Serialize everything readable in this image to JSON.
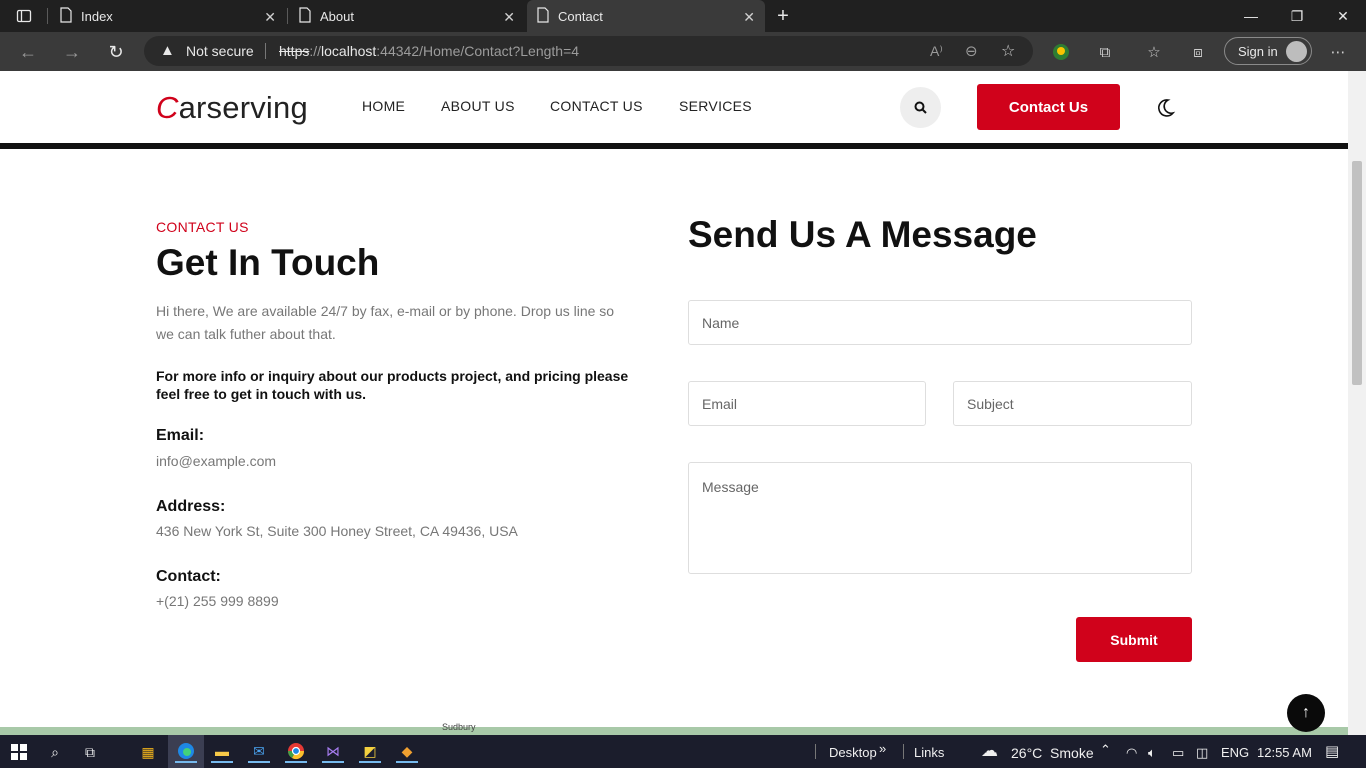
{
  "browser": {
    "tabs": [
      {
        "title": "Index",
        "active": false
      },
      {
        "title": "About",
        "active": false
      },
      {
        "title": "Contact",
        "active": true
      }
    ],
    "new_tab_icon": "plus-icon",
    "window_controls": [
      "minimize-icon",
      "restore-icon",
      "close-icon"
    ],
    "address": {
      "security_label": "Not secure",
      "url_scheme": "https",
      "url_host": "localhost",
      "url_rest": ":44342/Home/Contact?Length=4"
    },
    "profile": {
      "signin_label": "Sign in"
    }
  },
  "site": {
    "logo_initial": "C",
    "logo_rest": "arserving",
    "nav": {
      "home": "HOME",
      "about": "ABOUT US",
      "contact": "CONTACT US",
      "services": "SERVICES"
    },
    "header_cta": "Contact Us",
    "accent_color": "#d0021b"
  },
  "contact": {
    "kicker": "CONTACT US",
    "title": "Get In Touch",
    "intro": "Hi there, We are available 24/7 by fax, e-mail or by phone. Drop us line so we can talk futher about that.",
    "note": "For more info or inquiry about our products project, and pricing please feel free to get in touch with us.",
    "email": {
      "label": "Email:",
      "value": "info@example.com"
    },
    "address": {
      "label": "Address:",
      "value": "436 New York St, Suite 300 Honey Street, CA 49436, USA"
    },
    "phone": {
      "label": "Contact:",
      "value": "+(21) 255 999 8899"
    }
  },
  "form": {
    "title": "Send Us A Message",
    "name_placeholder": "Name",
    "email_placeholder": "Email",
    "subject_placeholder": "Subject",
    "message_placeholder": "Message",
    "submit_label": "Submit"
  },
  "map": {
    "place_label": "Sudbury"
  },
  "taskbar": {
    "desktop_label": "Desktop",
    "links_label": "Links",
    "weather": "26°C  Smoke",
    "language": "ENG",
    "time": "12:55 AM"
  }
}
